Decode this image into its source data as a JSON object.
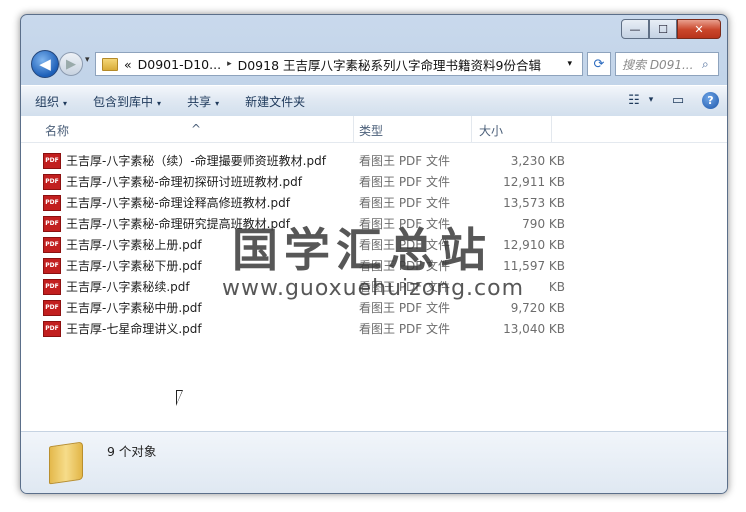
{
  "window": {
    "controls": {
      "minimize": "—",
      "maximize": "☐",
      "close": "✕"
    }
  },
  "nav": {
    "back_icon": "◀",
    "forward_icon": "▶",
    "dropdown_icon": "▾",
    "breadcrumb_overflow": "«",
    "crumb_1": "D0901-D10...",
    "crumb_sep": "▸",
    "crumb_2": "D0918 王吉厚八字素秘系列八字命理书籍资料9份合辑",
    "address_dropdown": "▾",
    "refresh_icon": "⟳",
    "search_placeholder": "搜索 D091...",
    "search_icon": "⌕"
  },
  "toolbar": {
    "organize": "组织",
    "include_library": "包含到库中",
    "share": "共享",
    "new_folder": "新建文件夹",
    "dd": "▾",
    "view_icon": "☷",
    "view_dd": "▾",
    "preview_icon": "▭",
    "help_icon": "?"
  },
  "columns": {
    "name": "名称",
    "type": "类型",
    "size": "大小",
    "sort_arrow": "^"
  },
  "files": [
    {
      "name": "王吉厚-八字素秘（续）-命理撮要师资班教材.pdf",
      "type": "看图王 PDF 文件",
      "size": "3,230 KB"
    },
    {
      "name": "王吉厚-八字素秘-命理初探研讨班班教材.pdf",
      "type": "看图王 PDF 文件",
      "size": "12,911 KB"
    },
    {
      "name": "王吉厚-八字素秘-命理诠释高修班教材.pdf",
      "type": "看图王 PDF 文件",
      "size": "13,573 KB"
    },
    {
      "name": "王吉厚-八字素秘-命理研究提高班教材.pdf",
      "type": "看图王 PDF 文件",
      "size": "790 KB"
    },
    {
      "name": "王吉厚-八字素秘上册.pdf",
      "type": "看图王 PDF 文件",
      "size": "12,910 KB"
    },
    {
      "name": "王吉厚-八字素秘下册.pdf",
      "type": "看图王 PDF 文件",
      "size": "11,597 KB"
    },
    {
      "name": "王吉厚-八字素秘续.pdf",
      "type": "看图王 PDF 文件",
      "size": "KB"
    },
    {
      "name": "王吉厚-八字素秘中册.pdf",
      "type": "看图王 PDF 文件",
      "size": "9,720 KB"
    },
    {
      "name": "王吉厚-七星命理讲义.pdf",
      "type": "看图王 PDF 文件",
      "size": "13,040 KB"
    }
  ],
  "pdf_badge": "PDF",
  "watermark": {
    "cn": "国学汇总站",
    "en": "www.guoxuehuizong.com"
  },
  "status": {
    "count_text": "9 个对象"
  }
}
